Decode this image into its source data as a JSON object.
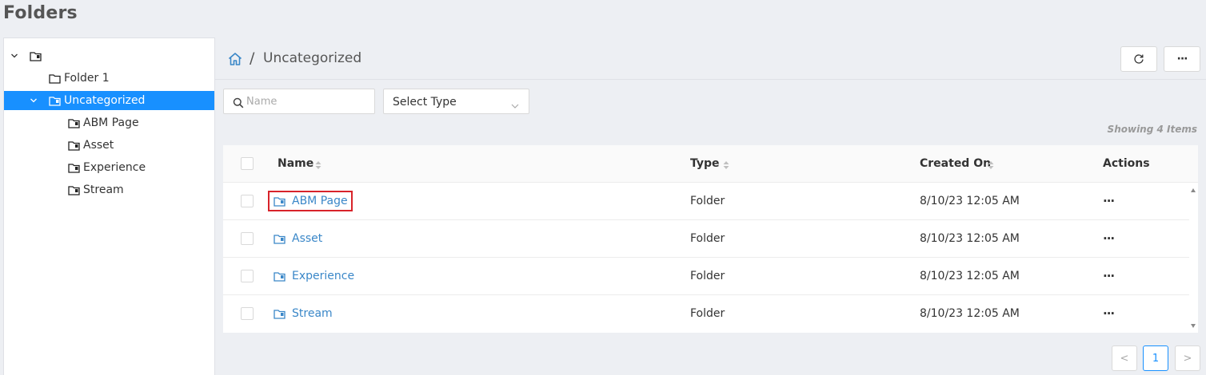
{
  "page": {
    "title": "Folders"
  },
  "tree": {
    "root": {
      "label": ""
    },
    "items": [
      {
        "label": "Folder 1"
      },
      {
        "label": "Uncategorized"
      },
      {
        "label": "ABM Page"
      },
      {
        "label": "Asset"
      },
      {
        "label": "Experience"
      },
      {
        "label": "Stream"
      }
    ]
  },
  "breadcrumb": {
    "separator": "/",
    "current": "Uncategorized"
  },
  "toolbar": {
    "more_label": "···"
  },
  "filters": {
    "search_placeholder": "Name",
    "search_value": "",
    "type_select": "Select Type"
  },
  "showing": "Showing 4 Items",
  "table": {
    "headers": {
      "name": "Name",
      "type": "Type",
      "created": "Created On",
      "actions": "Actions"
    },
    "rows": [
      {
        "name": "ABM Page",
        "type": "Folder",
        "created": "8/10/23 12:05 AM",
        "actions": "···"
      },
      {
        "name": "Asset",
        "type": "Folder",
        "created": "8/10/23 12:05 AM",
        "actions": "···"
      },
      {
        "name": "Experience",
        "type": "Folder",
        "created": "8/10/23 12:05 AM",
        "actions": "···"
      },
      {
        "name": "Stream",
        "type": "Folder",
        "created": "8/10/23 12:05 AM",
        "actions": "···"
      }
    ]
  },
  "pagination": {
    "prev": "<",
    "current": "1",
    "next": ">"
  },
  "icons": {
    "tree_expand": "chevron-down-icon",
    "folder_outline": "folder-outline-icon",
    "folder_tagged": "folder-tagged-icon",
    "home": "home-icon",
    "refresh": "refresh-icon",
    "search": "search-icon",
    "sort": "sort-icon"
  },
  "colors": {
    "accent": "#1890ff",
    "link": "#3a87c8",
    "highlight_border": "#d8232a",
    "background": "#edeff3"
  }
}
